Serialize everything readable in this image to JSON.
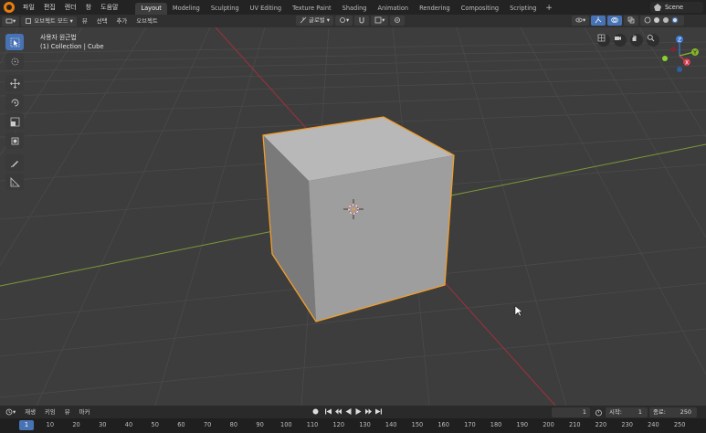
{
  "menu": {
    "items": [
      "파일",
      "편집",
      "렌더",
      "창",
      "도움말"
    ]
  },
  "workspaces": {
    "tabs": [
      {
        "label": "Layout",
        "active": true
      },
      {
        "label": "Modeling",
        "active": false
      },
      {
        "label": "Sculpting",
        "active": false
      },
      {
        "label": "UV Editing",
        "active": false
      },
      {
        "label": "Texture Paint",
        "active": false
      },
      {
        "label": "Shading",
        "active": false
      },
      {
        "label": "Animation",
        "active": false
      },
      {
        "label": "Rendering",
        "active": false
      },
      {
        "label": "Compositing",
        "active": false
      },
      {
        "label": "Scripting",
        "active": false
      }
    ],
    "add_label": "+"
  },
  "scene": {
    "name": "Scene"
  },
  "viewport_header": {
    "mode": "오브젝트 모드",
    "view": "뷰",
    "select": "선택",
    "add": "추가",
    "object": "오브젝트",
    "transform_orientation": "글로벌"
  },
  "viewport": {
    "view_name": "사용자 원근법",
    "collection": "(1) Collection | Cube"
  },
  "tools": [
    {
      "name": "select-box-icon",
      "active": true
    },
    {
      "name": "cursor-icon",
      "active": false
    },
    {
      "name": "move-icon",
      "active": false
    },
    {
      "name": "rotate-icon",
      "active": false
    },
    {
      "name": "scale-icon",
      "active": false
    },
    {
      "name": "transform-icon",
      "active": false
    },
    {
      "name": "annotate-icon",
      "active": false
    },
    {
      "name": "measure-icon",
      "active": false
    }
  ],
  "gizmo": {
    "x": "X",
    "y": "Y",
    "z": "Z"
  },
  "colors": {
    "accent": "#4772b3",
    "selection": "#f29d29",
    "x_axis": "#d23c4e",
    "y_axis": "#87b52a",
    "z_axis": "#3b7ad6"
  },
  "timeline": {
    "playback": "재생",
    "keying": "키잉",
    "view": "뷰",
    "marker": "마커",
    "current_frame": "1",
    "start_label": "시작:",
    "start_value": "1",
    "end_label": "종료:",
    "end_value": "250",
    "ruler_current": "1",
    "ruler_ticks": [
      "10",
      "20",
      "30",
      "40",
      "50",
      "60",
      "70",
      "80",
      "90",
      "100",
      "110",
      "120",
      "130",
      "140",
      "150",
      "160",
      "170",
      "180",
      "190",
      "200",
      "210",
      "220",
      "230",
      "240",
      "250"
    ]
  }
}
